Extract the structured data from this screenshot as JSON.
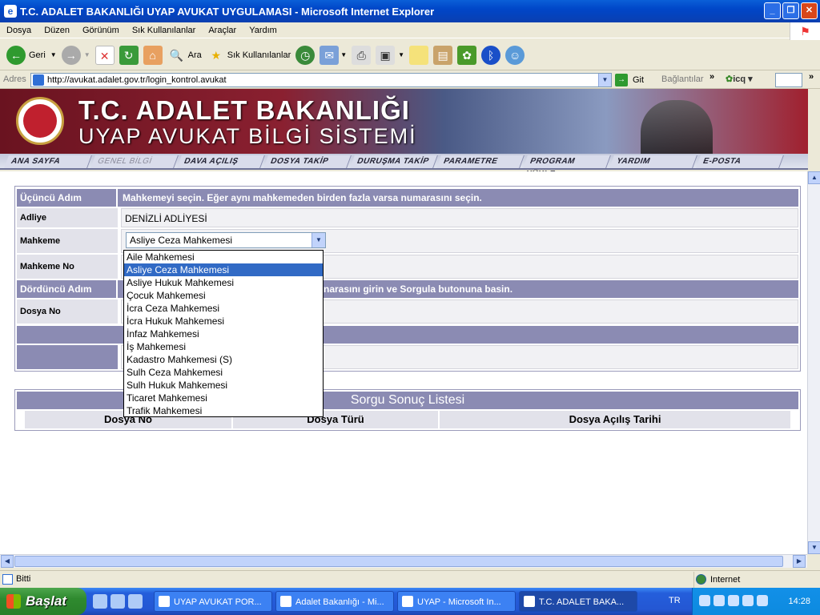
{
  "window": {
    "title": "T.C. ADALET BAKANLIĞI UYAP AVUKAT UYGULAMASI - Microsoft Internet Explorer"
  },
  "menu": [
    "Dosya",
    "Düzen",
    "Görünüm",
    "Sık Kullanılanlar",
    "Araçlar",
    "Yardım"
  ],
  "toolbar": {
    "back": "Geri",
    "search": "Ara",
    "favorites": "Sık Kullanılanlar"
  },
  "address": {
    "label": "Adres",
    "url": "http://avukat.adalet.gov.tr/login_kontrol.avukat",
    "go": "Git",
    "links": "Bağlantılar",
    "icq": "icq"
  },
  "banner": {
    "line1": "T.C. ADALET BAKANLIĞI",
    "line2": "UYAP AVUKAT BİLGİ SİSTEMİ",
    "emblem_text": "T.C. ADALET BAKANLIĞI"
  },
  "nav": [
    "ANA SAYFA",
    "GENEL BİLGİ",
    "DAVA AÇILIŞ",
    "DOSYA TAKİP",
    "DURUŞMA TAKİP",
    "PARAMETRE",
    "PROGRAM YÜKLE",
    "YARDIM",
    "E-POSTA"
  ],
  "form": {
    "step3_label": "Üçüncü Adım",
    "step3_text": "Mahkemeyi seçin. Eğer aynı mahkemeden birden fazla varsa numarasını seçin.",
    "adliye_label": "Adliye",
    "adliye_value": "DENİZLİ ADLİYESİ",
    "mahkeme_label": "Mahkeme",
    "mahkeme_selected": "Asliye Ceza Mahkemesi",
    "mahkeme_no_label": "Mahkeme No",
    "step4_label": "Dördüncü Adım",
    "step4_text": "narasını girin ve Sorgula butonuna basin.",
    "dosya_no_label": "Dosya No"
  },
  "dropdown_options": [
    "Aile Mahkemesi",
    "Asliye Ceza Mahkemesi",
    "Asliye Hukuk Mahkemesi",
    "Çocuk Mahkemesi",
    "İcra Ceza Mahkemesi",
    "İcra Hukuk Mahkemesi",
    "İnfaz Mahkemesi",
    "İş Mahkemesi",
    "Kadastro Mahkemesi (S)",
    "Sulh Ceza Mahkemesi",
    "Sulh Hukuk Mahkemesi",
    "Ticaret Mahkemesi",
    "Trafik Mahkemesi"
  ],
  "dropdown_selected_index": 1,
  "results": {
    "title": "Sorgu Sonuç Listesi",
    "columns": [
      "Dosya No",
      "Dosya Türü",
      "Dosya Açılış Tarihi"
    ]
  },
  "status": {
    "text": "Bitti",
    "zone": "Internet"
  },
  "taskbar": {
    "start": "Başlat",
    "tasks": [
      "UYAP AVUKAT POR...",
      "Adalet Bakanlığı - Mi...",
      "UYAP - Microsoft In...",
      "T.C. ADALET BAKA..."
    ],
    "lang": "TR",
    "clock": "14:28"
  },
  "colors": {
    "header_bar": "#8b8bb3",
    "selection": "#316ac5",
    "xp_blue": "#245edb"
  }
}
